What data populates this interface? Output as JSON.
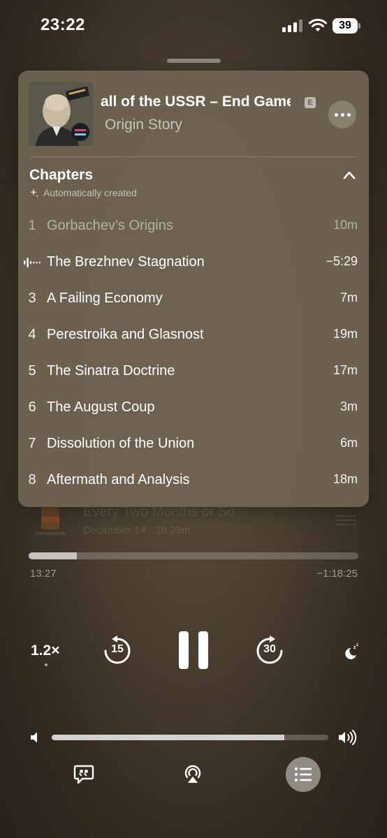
{
  "status_bar": {
    "time": "23:22",
    "battery": "39"
  },
  "now_playing": {
    "episode_title": "all of the USSR – End Game",
    "explicit_badge": "E",
    "show_name": "Origin Story",
    "artwork_icon": "gorbachev-portrait-artwork"
  },
  "chapters": {
    "title": "Chapters",
    "subtitle": "Automatically created",
    "current_index": 1,
    "items": [
      {
        "number": "1",
        "title": "Gorbachev’s Origins",
        "duration": "10m"
      },
      {
        "number": "",
        "title": "The Brezhnev Stagnation",
        "duration": "−5:29"
      },
      {
        "number": "3",
        "title": "A Failing Economy",
        "duration": "7m"
      },
      {
        "number": "4",
        "title": "Perestroika and Glasnost",
        "duration": "19m"
      },
      {
        "number": "5",
        "title": "The Sinatra Doctrine",
        "duration": "17m"
      },
      {
        "number": "6",
        "title": "The August Coup",
        "duration": "3m"
      },
      {
        "number": "7",
        "title": "Dissolution of the Union",
        "duration": "6m"
      },
      {
        "number": "8",
        "title": "Aftermath and Analysis",
        "duration": "18m"
      }
    ]
  },
  "up_next": {
    "title": "Every Two Months or So",
    "meta": "December 14 · 1h 29m"
  },
  "progress": {
    "elapsed": "13:27",
    "remaining": "−1:18:25",
    "fraction": 0.146
  },
  "controls": {
    "speed": "1.2×",
    "skip_back": "15",
    "skip_forward": "30"
  },
  "volume": {
    "level": 0.84
  },
  "colors": {
    "background": "#4a3f31",
    "popover": "#706452"
  }
}
